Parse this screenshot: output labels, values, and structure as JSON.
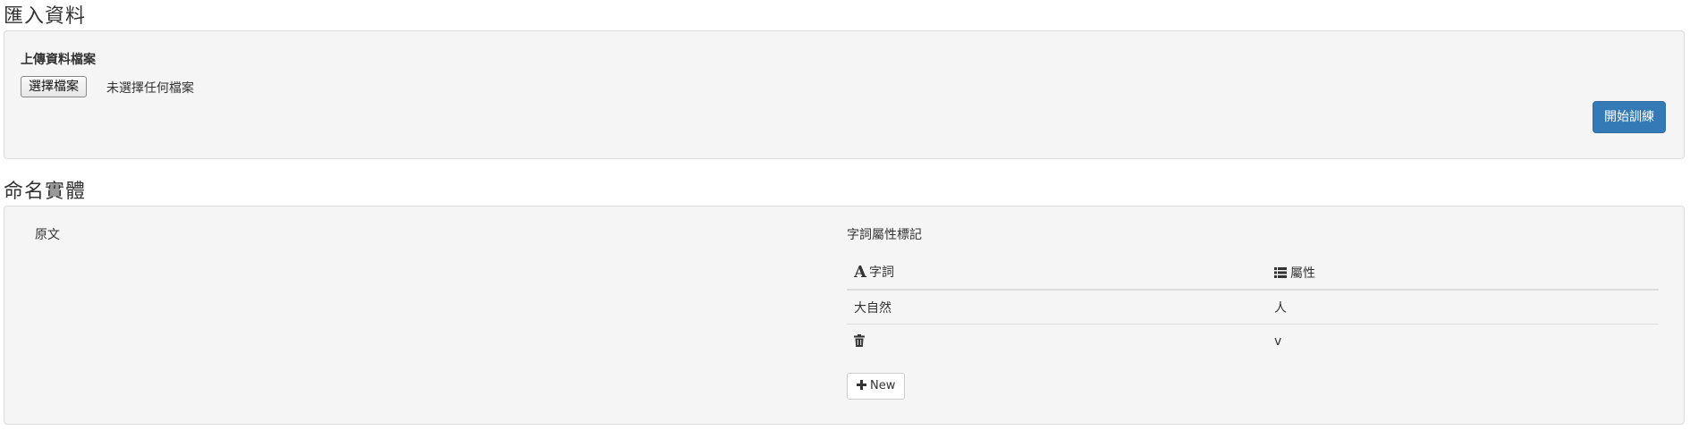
{
  "import_section": {
    "title": "匯入資料",
    "upload_label": "上傳資料檔案",
    "file_button_label": "選擇檔案",
    "file_status": "未選擇任何檔案",
    "train_button_label": "開始訓練"
  },
  "ner_section": {
    "title": "命名實體",
    "source_label": "原文",
    "tag_title": "字詞屬性標記",
    "table": {
      "headers": {
        "word_icon": "A",
        "word": "字詞",
        "attr": "屬性"
      },
      "rows": [
        {
          "word": "大自然",
          "attr": "人"
        },
        {
          "word": "",
          "attr": "v"
        }
      ]
    },
    "new_button_label": "New"
  },
  "icons": {
    "word_header": "font-icon",
    "attr_header": "list-icon",
    "row_delete": "trash-icon",
    "new_button": "plus-icon"
  },
  "colors": {
    "primary": "#337ab7",
    "well_bg": "#f5f5f5"
  }
}
